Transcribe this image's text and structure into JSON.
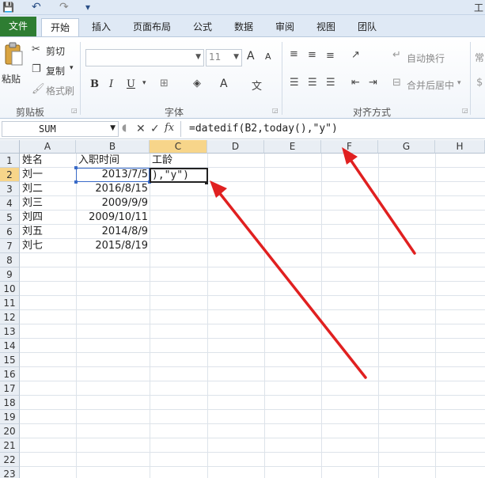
{
  "app": {
    "title_fragment": "工"
  },
  "quick_access": {
    "save": "💾",
    "undo": "↶",
    "redo": "↷",
    "customize": "▾"
  },
  "tabs": [
    {
      "label": "文件"
    },
    {
      "label": "开始"
    },
    {
      "label": "插入"
    },
    {
      "label": "页面布局"
    },
    {
      "label": "公式"
    },
    {
      "label": "数据"
    },
    {
      "label": "审阅"
    },
    {
      "label": "视图"
    },
    {
      "label": "团队"
    }
  ],
  "ribbon": {
    "clipboard": {
      "paste": "粘贴",
      "cut": "剪切",
      "copy": "复制",
      "format_painter": "格式刷",
      "group_label": "剪贴板"
    },
    "font": {
      "font_name": "",
      "font_size": "11",
      "grow": "A",
      "shrink": "A",
      "bold": "B",
      "italic": "I",
      "underline": "U",
      "group_label": "字体"
    },
    "alignment": {
      "wrap_text": "自动换行",
      "merge_center": "合并后居中",
      "group_label": "对齐方式"
    },
    "number": {
      "format": "常"
    }
  },
  "formula_bar": {
    "name_box": "SUM",
    "cancel": "✕",
    "enter": "✓",
    "fx": "fx",
    "formula": "=datedif(B2,today(),\"y\")"
  },
  "sheet": {
    "columns": [
      "A",
      "B",
      "C",
      "D",
      "E",
      "F",
      "G",
      "H"
    ],
    "rows": [
      "1",
      "2",
      "3",
      "4",
      "5",
      "6",
      "7",
      "8",
      "9",
      "10",
      "11",
      "12",
      "13",
      "14",
      "15",
      "16",
      "17",
      "18",
      "19",
      "20",
      "21",
      "22",
      "23"
    ],
    "headers": {
      "a1": "姓名",
      "b1": "入职时间",
      "c1": "工龄"
    },
    "data": [
      {
        "name": "刘一",
        "date": "2013/7/5"
      },
      {
        "name": "刘二",
        "date": "2016/8/15"
      },
      {
        "name": "刘三",
        "date": "2009/9/9"
      },
      {
        "name": "刘四",
        "date": "2009/10/11"
      },
      {
        "name": "刘五",
        "date": "2014/8/9"
      },
      {
        "name": "刘七",
        "date": "2015/8/19"
      }
    ],
    "active_cell_text": "),\"y\")"
  },
  "colors": {
    "file_tab": "#2e7d32",
    "selected_header": "#f7d58a",
    "arrow": "#e02020"
  }
}
